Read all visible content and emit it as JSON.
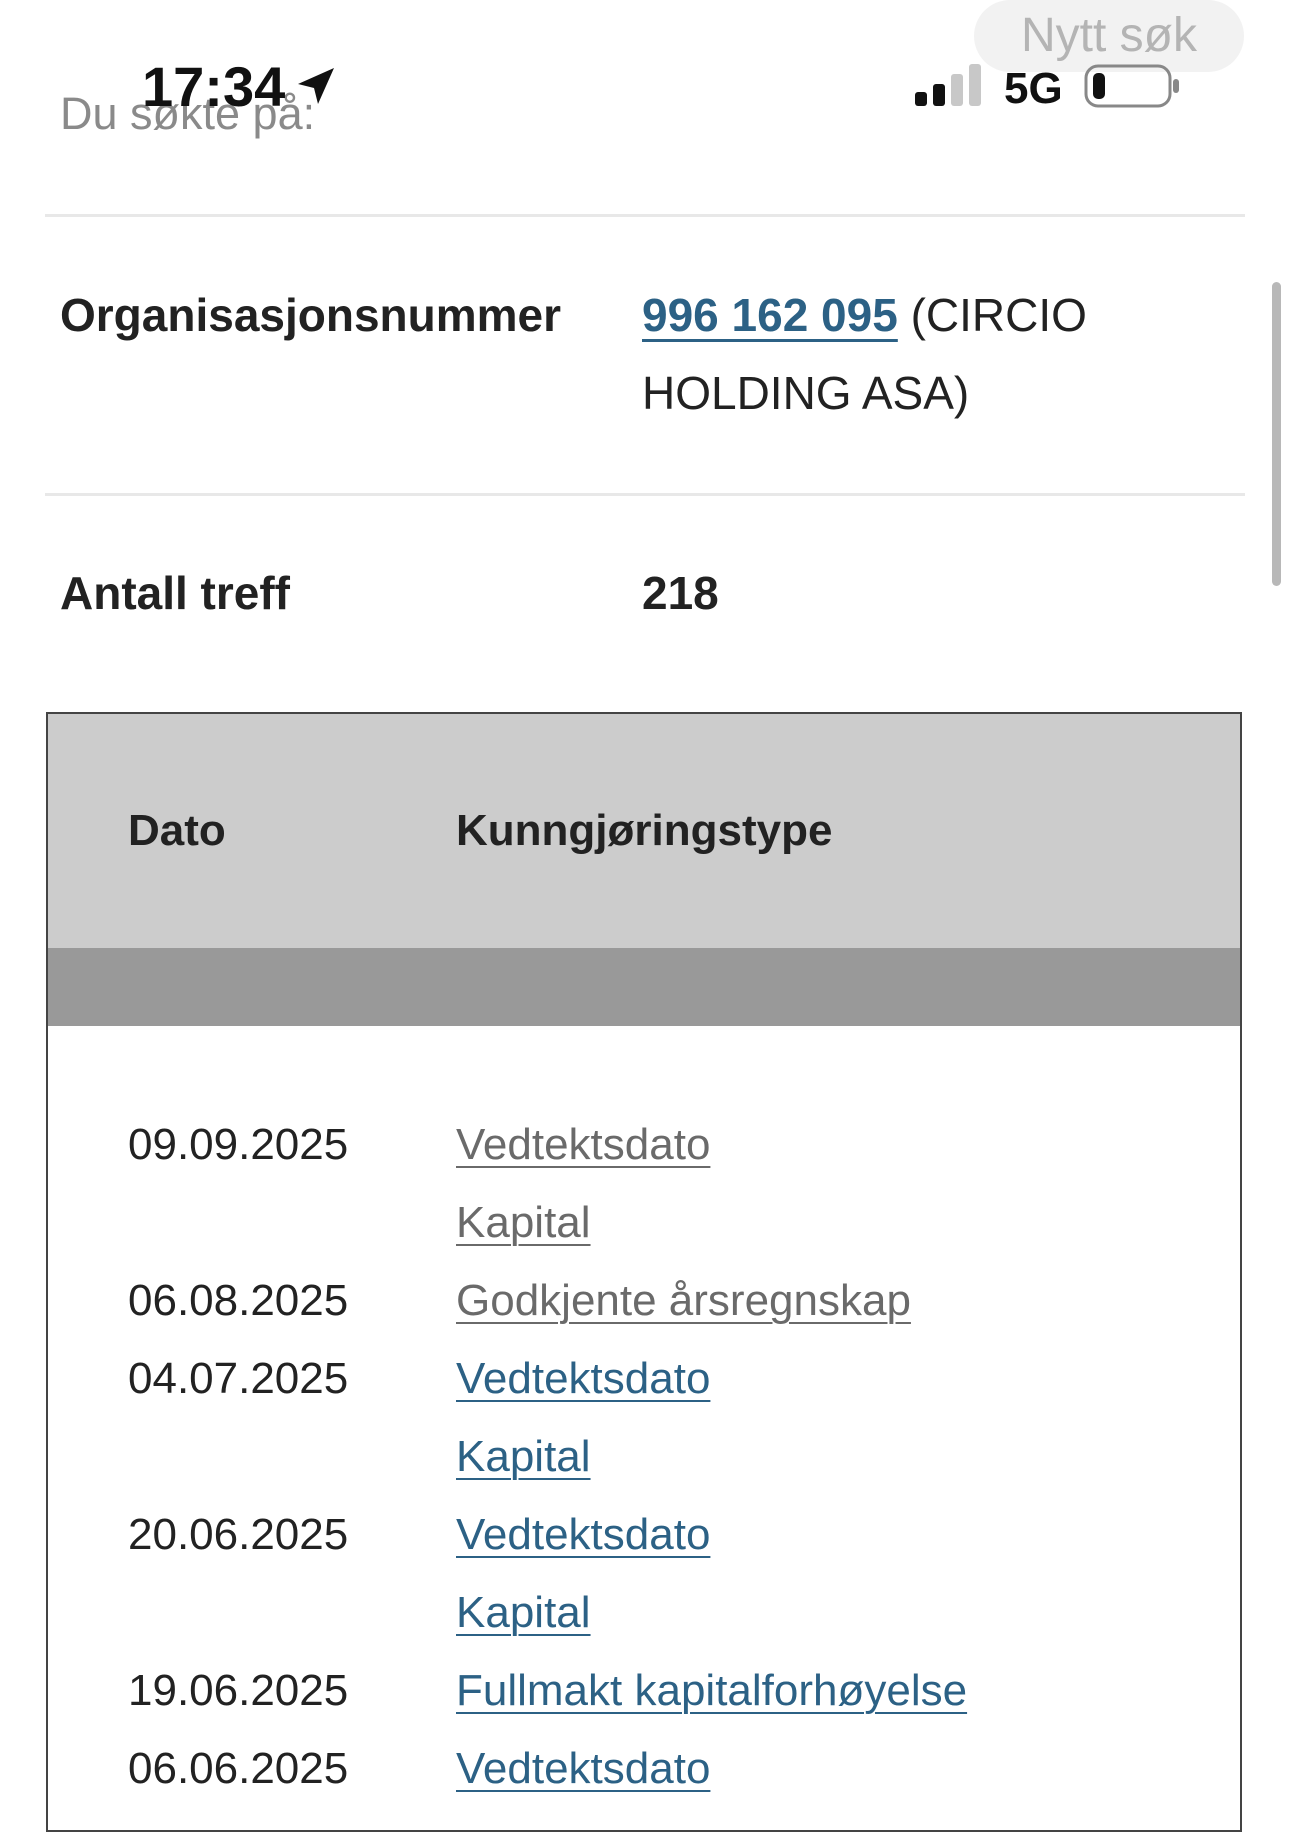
{
  "top": {
    "new_search_label": "Nytt søk",
    "searched_for_label": "Du søkte på:"
  },
  "status_bar": {
    "time": "17:34",
    "network": "5G",
    "icons": [
      "location-arrow-icon",
      "signal-icon",
      "battery-icon"
    ]
  },
  "search": {
    "org_label": "Organisasjonsnummer",
    "org_number": "996 162 095",
    "org_name": "(CIRCIO HOLDING ASA)",
    "hits_label": "Antall treff",
    "hits_value": "218"
  },
  "table": {
    "headers": [
      "Dato",
      "Kunngjøringstype"
    ],
    "rows": [
      {
        "date": "09.09.2025",
        "type": "Vedtektsdato",
        "visited": true
      },
      {
        "date": "",
        "type": "Kapital",
        "visited": true
      },
      {
        "date": "06.08.2025",
        "type": "Godkjente årsregnskap",
        "visited": true
      },
      {
        "date": "04.07.2025",
        "type": "Vedtektsdato",
        "visited": false
      },
      {
        "date": "",
        "type": "Kapital",
        "visited": false
      },
      {
        "date": "20.06.2025",
        "type": "Vedtektsdato",
        "visited": false
      },
      {
        "date": "",
        "type": "Kapital",
        "visited": false
      },
      {
        "date": "19.06.2025",
        "type": "Fullmakt kapitalforhøyelse",
        "visited": false
      },
      {
        "date": "06.06.2025",
        "type": "Vedtektsdato",
        "visited": false
      }
    ]
  },
  "colors": {
    "link": "#2c6185",
    "visited_link": "#6a6a6a",
    "table_header": "#cccccc",
    "table_subheader": "#999999"
  }
}
